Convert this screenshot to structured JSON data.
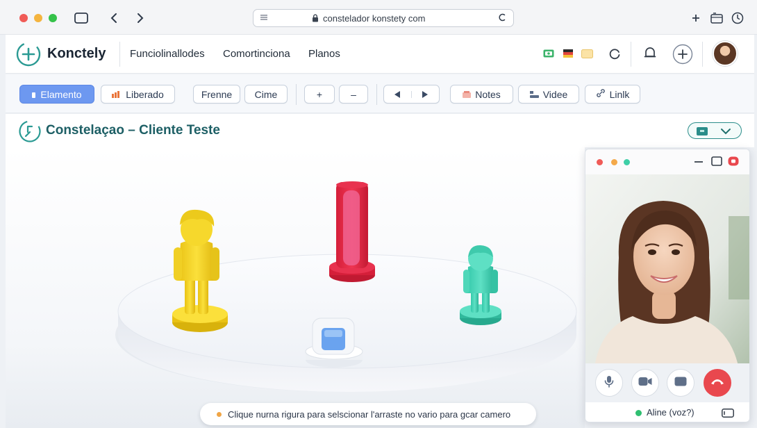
{
  "browser": {
    "url": "constelador konstety com"
  },
  "header": {
    "brand": "Konctely",
    "nav": [
      "Funciolinallodes",
      "Comortinciona",
      "Planos"
    ]
  },
  "toolbar": {
    "buttons": [
      "Elamento",
      "Liberado",
      "Frenne",
      "Cime",
      "+",
      "–",
      "Notes",
      "Videe",
      "Linlk"
    ]
  },
  "page": {
    "title": "Constelaçao – Cliente Teste"
  },
  "hint": {
    "text": "Clique nurna rigura para selscionar l'arraste no vario para gcar camero"
  },
  "call": {
    "participant_status": "Aline (voz?)"
  },
  "colors": {
    "accent": "#6d98f0",
    "brand_teal": "#1d5f65",
    "end_call": "#e9484e",
    "online": "#2fbf71"
  }
}
